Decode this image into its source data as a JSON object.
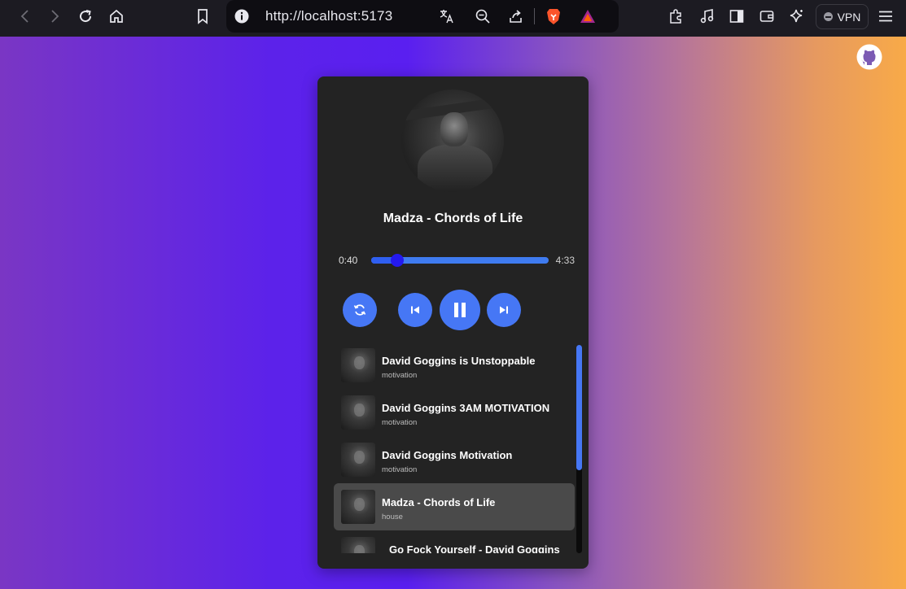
{
  "browser": {
    "url": "http://localhost:5173",
    "vpn_label": "VPN"
  },
  "player": {
    "now_playing": "Madza - Chords of Life",
    "current_time": "0:40",
    "duration": "4:33",
    "progress_fraction": 0.146,
    "accent_color": "#4677f5"
  },
  "playlist": [
    {
      "title": "David Goggins is Unstoppable",
      "genre": "motivation",
      "active": false
    },
    {
      "title": "David Goggins 3AM MOTIVATION",
      "genre": "motivation",
      "active": false
    },
    {
      "title": "David Goggins Motivation",
      "genre": "motivation",
      "active": false
    },
    {
      "title": "Madza - Chords of Life",
      "genre": "house",
      "active": true
    },
    {
      "title": "Go Fock Yourself - David Goggins",
      "genre": "",
      "active": false
    }
  ],
  "icons": {
    "repeat": "repeat-icon",
    "previous": "skip-previous-icon",
    "pause": "pause-icon",
    "next": "skip-next-icon",
    "github": "github-icon"
  }
}
